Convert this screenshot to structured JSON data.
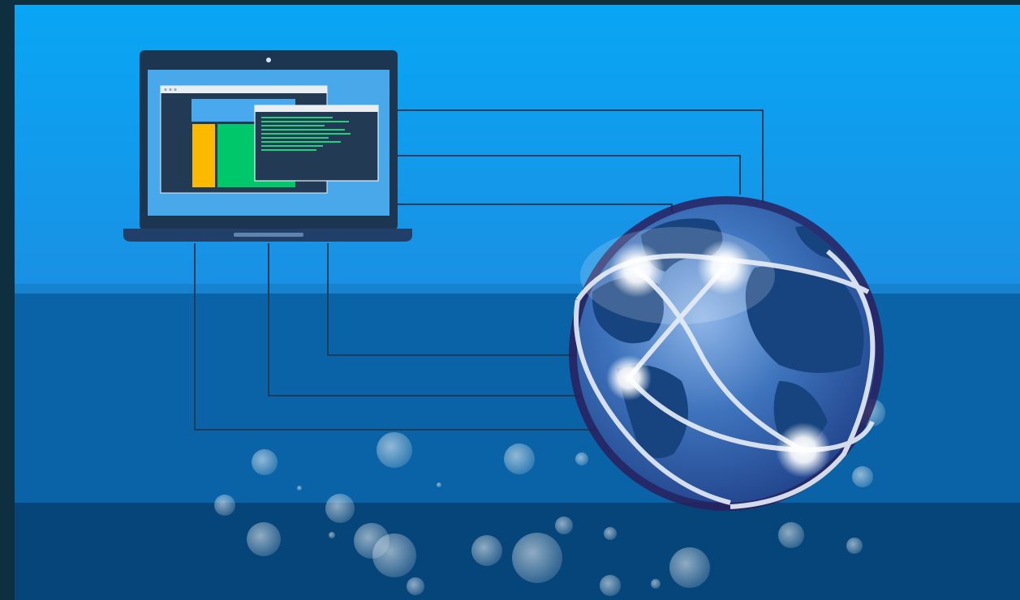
{
  "scene": {
    "subject": "laptop-connected-to-globe",
    "colors": {
      "frame": "#0d2f3f",
      "sky_top": "#0aa0f0",
      "sky_bottom": "#1e8fe0",
      "band_middle": "#0a64a8",
      "band_bottom": "#074477",
      "laptop_body": "#1c3550",
      "laptop_screen": "#47a5e8",
      "window_dark": "#233a55",
      "bar_yellow": "#fbb900",
      "bar_green": "#00c86a",
      "code_green": "#26d07c",
      "wire": "#1d3d5a",
      "globe_ocean": "#2d5fa8",
      "globe_land": "#16437f",
      "globe_rim": "#2a1f5c",
      "node_glow": "#ffffff"
    },
    "icons": [
      "laptop-icon",
      "browser-window-icon",
      "terminal-window-icon",
      "globe-icon",
      "network-node-icon",
      "bubble-icon"
    ]
  }
}
